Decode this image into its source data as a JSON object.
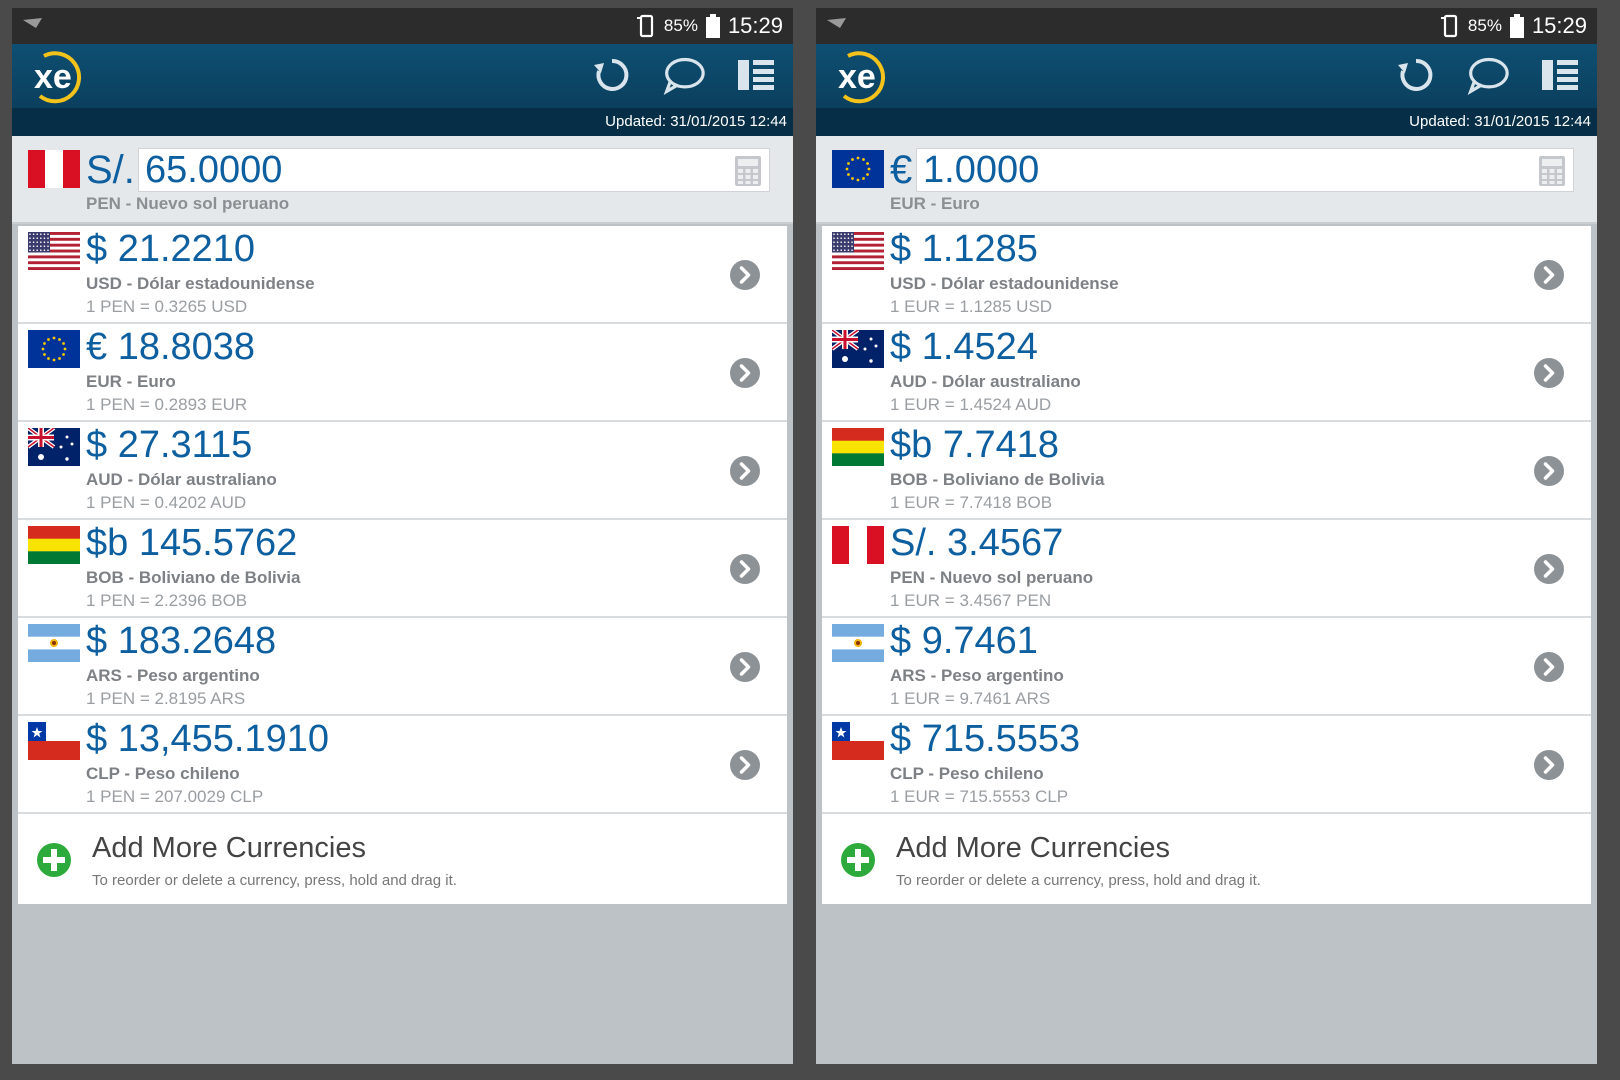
{
  "colors": {
    "header": "#0e4f72",
    "updated_bar": "#062f47",
    "value_text": "#0d5fa0",
    "add_icon": "#2daa3c"
  },
  "panels": [
    {
      "status": {
        "battery": "85%",
        "time": "15:29"
      },
      "logo_text": "xe",
      "updated": "Updated: 31/01/2015 12:44",
      "base": {
        "flag": "pe",
        "symbol": "S/.",
        "amount": "65.0000",
        "name": "PEN - Nuevo sol peruano"
      },
      "rows": [
        {
          "flag": "us",
          "value": "$ 21.2210",
          "name": "USD - Dólar estadounidense",
          "rate": "1 PEN = 0.3265 USD"
        },
        {
          "flag": "eu",
          "value": "€ 18.8038",
          "name": "EUR - Euro",
          "rate": "1 PEN = 0.2893 EUR"
        },
        {
          "flag": "au",
          "value": "$ 27.3115",
          "name": "AUD - Dólar australiano",
          "rate": "1 PEN = 0.4202 AUD"
        },
        {
          "flag": "bo",
          "value": "$b 145.5762",
          "name": "BOB - Boliviano de Bolivia",
          "rate": "1 PEN = 2.2396 BOB"
        },
        {
          "flag": "ar",
          "value": "$ 183.2648",
          "name": "ARS - Peso argentino",
          "rate": "1 PEN = 2.8195 ARS"
        },
        {
          "flag": "cl",
          "value": "$ 13,455.1910",
          "name": "CLP - Peso chileno",
          "rate": "1 PEN = 207.0029 CLP"
        }
      ],
      "add": {
        "title": "Add More Currencies",
        "hint": "To reorder or delete a currency, press, hold and drag it."
      }
    },
    {
      "status": {
        "battery": "85%",
        "time": "15:29"
      },
      "logo_text": "xe",
      "updated": "Updated: 31/01/2015 12:44",
      "base": {
        "flag": "eu",
        "symbol": "€",
        "amount": "1.0000",
        "name": "EUR - Euro"
      },
      "rows": [
        {
          "flag": "us",
          "value": "$ 1.1285",
          "name": "USD - Dólar estadounidense",
          "rate": "1 EUR = 1.1285 USD"
        },
        {
          "flag": "au",
          "value": "$ 1.4524",
          "name": "AUD - Dólar australiano",
          "rate": "1 EUR = 1.4524 AUD"
        },
        {
          "flag": "bo",
          "value": "$b 7.7418",
          "name": "BOB - Boliviano de Bolivia",
          "rate": "1 EUR = 7.7418 BOB"
        },
        {
          "flag": "pe",
          "value": "S/. 3.4567",
          "name": "PEN - Nuevo sol peruano",
          "rate": "1 EUR = 3.4567 PEN"
        },
        {
          "flag": "ar",
          "value": "$ 9.7461",
          "name": "ARS - Peso argentino",
          "rate": "1 EUR = 9.7461 ARS"
        },
        {
          "flag": "cl",
          "value": "$ 715.5553",
          "name": "CLP - Peso chileno",
          "rate": "1 EUR = 715.5553 CLP"
        }
      ],
      "add": {
        "title": "Add More Currencies",
        "hint": "To reorder or delete a currency, press, hold and drag it."
      }
    }
  ]
}
